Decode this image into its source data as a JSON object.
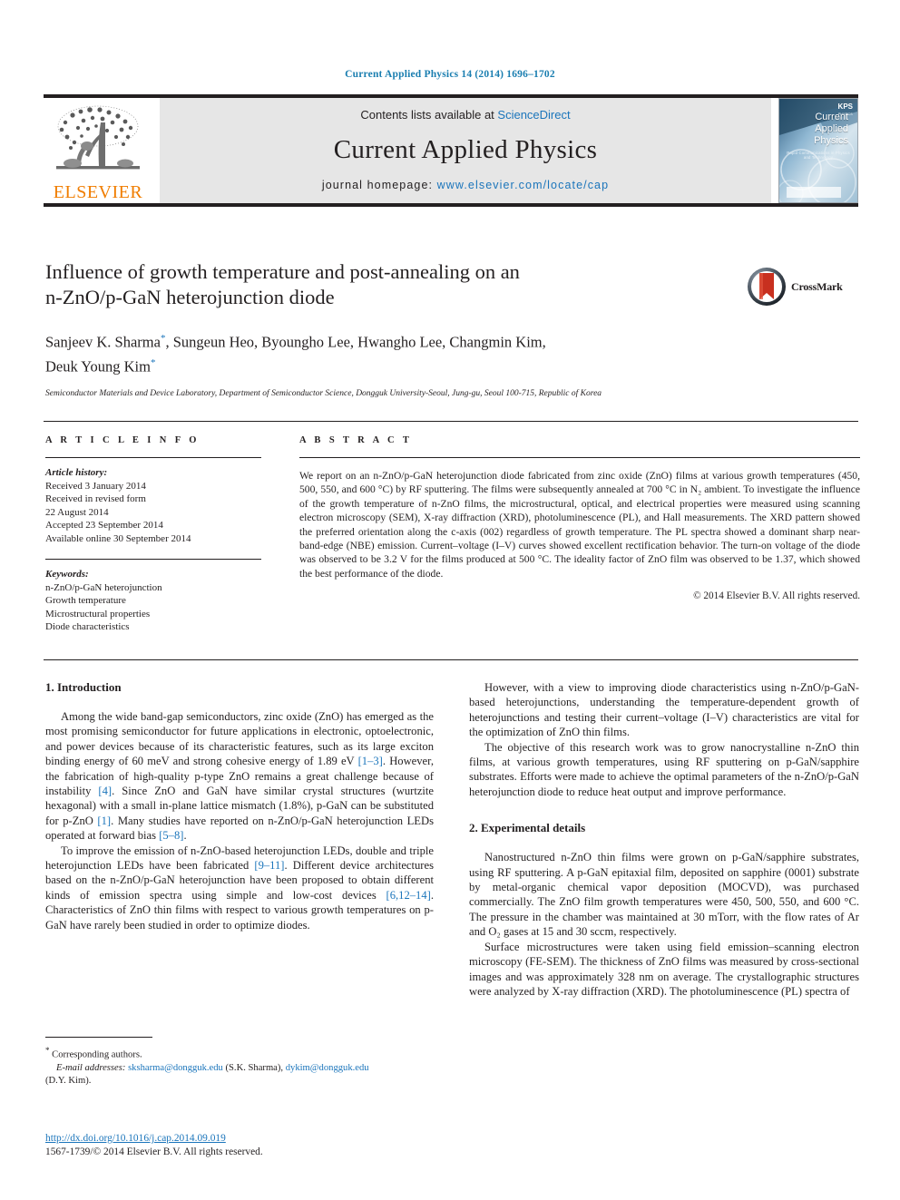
{
  "running_head": "Current Applied Physics 14 (2014) 1696–1702",
  "masthead": {
    "publisher_logo_text": "ELSEVIER",
    "contents_prefix": "Contents lists available at ",
    "contents_link": "ScienceDirect",
    "journal_title": "Current Applied Physics",
    "homepage_prefix": "journal homepage: ",
    "homepage_link": "www.elsevier.com/locate/cap",
    "cover": {
      "line1": "Current",
      "line2": "Applied",
      "line3": "Physics",
      "subtitle": "Rapid Communications in Physics and Technology",
      "society_badge": "KPS",
      "society_sub": "PHYSICS"
    }
  },
  "article": {
    "title_line1": "Influence of growth temperature and post-annealing on an",
    "title_line2": "n-ZnO/p-GaN heterojunction diode",
    "authors_line1": "Sanjeev K. Sharma",
    "authors_line1_rest": ", Sungeun Heo, Byoungho Lee, Hwangho Lee, Changmin Kim,",
    "authors_line2": "Deuk Young Kim",
    "affiliation": "Semiconductor Materials and Device Laboratory, Department of Semiconductor Science, Dongguk University-Seoul, Jung-gu, Seoul 100-715, Republic of Korea",
    "crossmark_label": "CrossMark"
  },
  "info": {
    "heading": "A R T I C L E   I N F O",
    "history_label": "Article history:",
    "history": [
      "Received 3 January 2014",
      "Received in revised form",
      "22 August 2014",
      "Accepted 23 September 2014",
      "Available online 30 September 2014"
    ],
    "keywords_label": "Keywords:",
    "keywords": [
      "n-ZnO/p-GaN heterojunction",
      "Growth temperature",
      "Microstructural properties",
      "Diode characteristics"
    ]
  },
  "abstract": {
    "heading": "A B S T R A C T",
    "text": "We report on an n-ZnO/p-GaN heterojunction diode fabricated from zinc oxide (ZnO) films at various growth temperatures (450, 500, 550, and 600 °C) by RF sputtering. The films were subsequently annealed at 700 °C in N₂ ambient. To investigate the influence of the growth temperature of n-ZnO films, the microstructural, optical, and electrical properties were measured using scanning electron microscopy (SEM), X-ray diffraction (XRD), photoluminescence (PL), and Hall measurements. The XRD pattern showed the preferred orientation along the c-axis (002) regardless of growth temperature. The PL spectra showed a dominant sharp near-band-edge (NBE) emission. Current–voltage (I–V) curves showed excellent rectification behavior. The turn-on voltage of the diode was observed to be 3.2 V for the films produced at 500 °C. The ideality factor of ZnO film was observed to be 1.37, which showed the best performance of the diode.",
    "copyright": "© 2014 Elsevier B.V. All rights reserved."
  },
  "sections": {
    "intro_heading": "1. Introduction",
    "intro_p1_a": "Among the wide band-gap semiconductors, zinc oxide (ZnO) has emerged as the most promising semiconductor for future applications in electronic, optoelectronic, and power devices because of its characteristic features, such as its large exciton binding energy of 60 meV and strong cohesive energy of 1.89 eV ",
    "intro_p1_ref1": "[1–3]",
    "intro_p1_b": ". However, the fabrication of high-quality p-type ZnO remains a great challenge because of instability ",
    "intro_p1_ref2": "[4]",
    "intro_p1_c": ". Since ZnO and GaN have similar crystal structures (wurtzite hexagonal) with a small in-plane lattice mismatch (1.8%), p-GaN can be substituted for p-ZnO ",
    "intro_p1_ref3": "[1]",
    "intro_p1_d": ". Many studies have reported on n-ZnO/p-GaN heterojunction LEDs operated at forward bias ",
    "intro_p1_ref4": "[5–8]",
    "intro_p1_e": ".",
    "intro_p2_a": "To improve the emission of n-ZnO-based heterojunction LEDs, double and triple heterojunction LEDs have been fabricated ",
    "intro_p2_ref1": "[9–11]",
    "intro_p2_b": ". Different device architectures based on the n-ZnO/p-GaN heterojunction have been proposed to obtain different kinds of emission spectra using simple and low-cost devices ",
    "intro_p2_ref2": "[6,12–14]",
    "intro_p2_c": ". Characteristics of ZnO thin films with respect to various growth temperatures on p-GaN have rarely been studied in order to optimize diodes.",
    "right_p1": "However, with a view to improving diode characteristics using n-ZnO/p-GaN-based heterojunctions, understanding the temperature-dependent growth of heterojunctions and testing their current–voltage (I–V) characteristics are vital for the optimization of ZnO thin films.",
    "right_p2": "The objective of this research work was to grow nanocrystalline n-ZnO thin films, at various growth temperatures, using RF sputtering on p-GaN/sapphire substrates. Efforts were made to achieve the optimal parameters of the n-ZnO/p-GaN heterojunction diode to reduce heat output and improve performance.",
    "exp_heading": "2. Experimental details",
    "exp_p1": "Nanostructured n-ZnO thin films were grown on p-GaN/sapphire substrates, using RF sputtering. A p-GaN epitaxial film, deposited on sapphire (0001) substrate by metal-organic chemical vapor deposition (MOCVD), was purchased commercially. The ZnO film growth temperatures were 450, 500, 550, and 600 °C. The pressure in the chamber was maintained at 30 mTorr, with the flow rates of Ar and O₂ gases at 15 and 30 sccm, respectively.",
    "exp_p2": "Surface microstructures were taken using field emission–scanning electron microscopy (FE-SEM). The thickness of ZnO films was measured by cross-sectional images and was approximately 328 nm on average. The crystallographic structures were analyzed by X-ray diffraction (XRD). The photoluminescence (PL) spectra of"
  },
  "footnotes": {
    "corresponding": "Corresponding authors.",
    "email_label": "E-mail addresses:",
    "email1": "sksharma@dongguk.edu",
    "email1_who": " (S.K. Sharma), ",
    "email2": "dykim@dongguk.edu",
    "email2_who": "(D.Y. Kim).",
    "doi": "http://dx.doi.org/10.1016/j.cap.2014.09.019",
    "issn_line": "1567-1739/© 2014 Elsevier B.V. All rights reserved."
  },
  "colors": {
    "link": "#1b75bb",
    "running_head": "#1a7eb0",
    "elsevier_orange": "#f07d00",
    "banner_bg": "#e6e6e6",
    "rule": "#231f20"
  }
}
